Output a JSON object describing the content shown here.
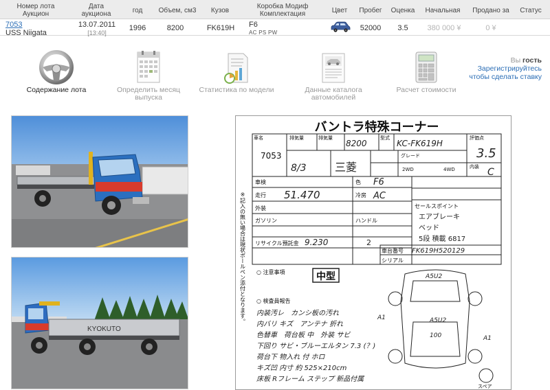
{
  "table": {
    "headers": {
      "lot": [
        "Номер лота",
        "Аукцион"
      ],
      "date": [
        "Дата",
        "аукциона"
      ],
      "year": "год",
      "volume": "Объем, см3",
      "body": "Кузов",
      "trans": [
        "Коробка Модиф",
        "Комплектация"
      ],
      "color": "Цвет",
      "mileage": "Пробег",
      "rating": "Оценка",
      "start": "Начальная",
      "sold": "Продано за",
      "status": "Статус"
    },
    "row": {
      "lot_number": "7053",
      "auction": "USS Niigata",
      "date": "13.07.2011",
      "time": "[13:40]",
      "year": "1996",
      "volume": "8200",
      "body": "FK619H",
      "trans": "F6",
      "options": "AC PS PW",
      "mileage": "52000",
      "rating": "3.5",
      "start_price": "380 000 ¥",
      "sold_price": "0 ¥",
      "status": ""
    }
  },
  "tools": [
    {
      "label": "Содержание лота",
      "icon": "steering-wheel-icon",
      "active": true
    },
    {
      "label": "Определить месяц выпуска",
      "icon": "calendar-icon",
      "active": false
    },
    {
      "label": "Статистика по модели",
      "icon": "statistics-icon",
      "active": false
    },
    {
      "label": "Данные каталога автомобилей",
      "icon": "catalog-icon",
      "active": false
    },
    {
      "label": "Расчет стоимости",
      "icon": "calculator-icon",
      "active": false
    }
  ],
  "guest": {
    "prefix": "Вы",
    "word": "гость",
    "register": "Зарегистрируйтесь",
    "register2": "чтобы сделать ставку"
  },
  "sheet": {
    "title": "バントラ特殊コーナー",
    "lot": "7053",
    "displacement": "8200",
    "model": "KC-FK619H",
    "score": "3.5",
    "interior": "C",
    "year": "8/3",
    "maker": "三菱",
    "mileage": "51.470",
    "trans": "F6",
    "ac": "AC",
    "price": "9.230",
    "capacity": "2",
    "chassis": "FK619H520129",
    "body_size": "中型",
    "notes": [
      "内装汚レ　カンシ板の汚れ",
      "内バリ キズ　アンテナ 折れ",
      "色替車　荷台板 中　外装 サビ",
      "下回り サビ・ブルーエルタン 7.3 (？)",
      "荷台下 物入れ 付 ホロ",
      "キズ凹 内寸 約 525×210cm",
      "床板 Rフレーム ステップ 新品付属"
    ],
    "sales_point": [
      "エアブレーキ",
      "ベッド",
      "5段 積載 6817"
    ],
    "diagram_labels": [
      "A1",
      "A1",
      "A5U2",
      "A5U2",
      "100"
    ],
    "spare": "スペア",
    "left_note": "※記入の無い場合は現状ボールペン添付となります。",
    "labels": {
      "car_name": "車名",
      "displacement": "排気量",
      "model": "型式",
      "score": "評価点",
      "inspection": "車検",
      "mileage": "走行",
      "color": "色",
      "grade": "グレード",
      "exterior": "外装",
      "interior_label": "内装",
      "fuel": "ガソリン",
      "cooling": "冷房",
      "handle": "ハンドル",
      "recycle": "リサイクル預託金",
      "notice": "注意事項",
      "inspector": "検査員報告",
      "sales": "セールスポイント",
      "chassis_no": "車台番号",
      "serial": "シリアル"
    }
  }
}
